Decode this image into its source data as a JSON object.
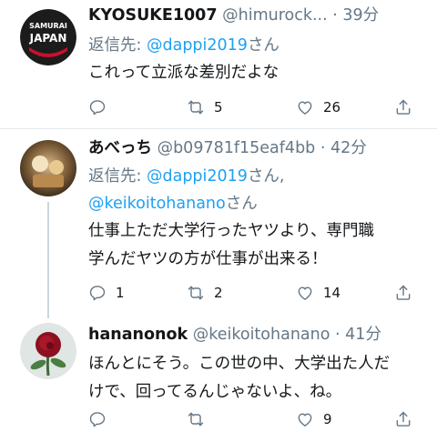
{
  "tweets": [
    {
      "name": "KYOSUKE1007",
      "handle": "@himurock...",
      "time": "39分",
      "replying_label": "返信先:",
      "replying_to": "@dappi2019",
      "replying_suffix": "さん",
      "text": "これって立派な差別だよな",
      "reply_count": "",
      "retweet_count": "5",
      "like_count": "26",
      "avatar_logo": {
        "line1": "SAMURAI",
        "line2": "JAPAN"
      }
    },
    {
      "name": "あべっち",
      "handle": "@b09781f15eaf4bb",
      "time": "42分",
      "replying_label": "返信先:",
      "replying_to": "@dappi2019",
      "replying_mid": "さん,",
      "replying_to_2": "@keikoitohanano",
      "replying_suffix": "さん",
      "text_line1": "仕事上ただ大学行ったヤツより、専門職",
      "text_line2": "学んだヤツの方が仕事が出来る！",
      "reply_count": "1",
      "retweet_count": "2",
      "like_count": "14"
    },
    {
      "name": "hananonok",
      "handle": "@keikoitohanano",
      "time": "41分",
      "text_line1": "ほんとにそう。この世の中、大学出た人だ",
      "text_line2": "けで、回ってるんじゃないよ、ね。",
      "reply_count": "",
      "retweet_count": "",
      "like_count": "9"
    }
  ],
  "separator": "·",
  "icons": [
    "reply-icon",
    "retweet-icon",
    "like-icon",
    "share-icon"
  ],
  "colors": {
    "link": "#1da1f2",
    "muted": "#657786",
    "text": "#14171a",
    "divider": "#e1e8ed"
  }
}
